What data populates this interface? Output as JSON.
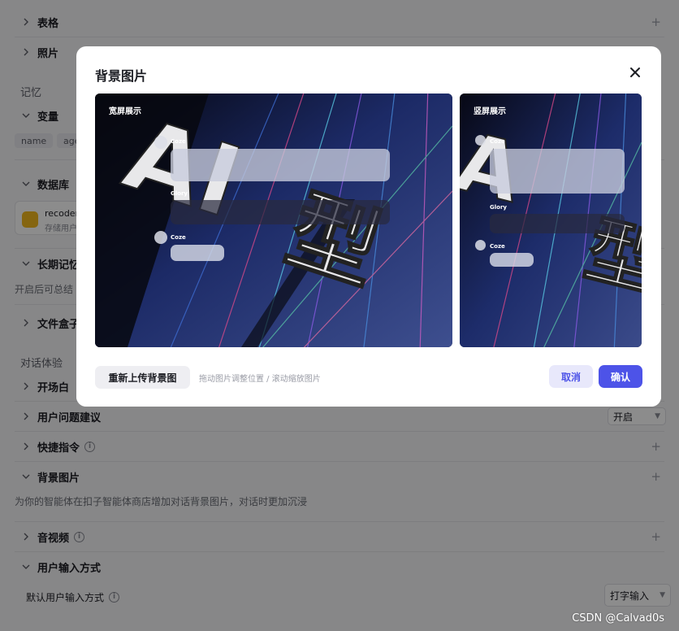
{
  "settings": {
    "rows": {
      "table": "表格",
      "photo": "照片",
      "variables": "变量",
      "database": "数据库",
      "long_term_memory": "长期记忆",
      "file_box": "文件盒子",
      "opening": "开场白",
      "question_suggest": "用户问题建议",
      "shortcut": "快捷指令",
      "bg_image": "背景图片",
      "av": "音视频",
      "input_mode": "用户输入方式"
    },
    "groups": {
      "memory": "记忆",
      "dialog": "对话体验"
    },
    "chips": [
      "name",
      "age"
    ],
    "database_card": {
      "title": "recoder",
      "subtitle": "存储用户"
    },
    "long_term_memory_desc": "开启后可总结",
    "bg_image_desc": "为你的智能体在扣子智能体商店增加对话背景图片，对话时更加沉浸",
    "question_suggest_value": "开启",
    "default_input_label": "默认用户输入方式",
    "default_input_value": "打字输入"
  },
  "modal": {
    "title": "背景图片",
    "wide_label": "宽屏展示",
    "tall_label": "竖屏展示",
    "sender_1": "Coze",
    "sender_2": "Glory",
    "sender_3": "Coze",
    "reupload_label": "重新上传背景图",
    "hint": "拖动图片调整位置 / 滚动缩放图片",
    "cancel_label": "取消",
    "confirm_label": "确认"
  },
  "watermark": "CSDN @Calvad0s",
  "colors": {
    "accent": "#4d53e8",
    "accent_soft": "#e8e8fb",
    "overlay": "rgba(0,0,0,0.45)"
  }
}
